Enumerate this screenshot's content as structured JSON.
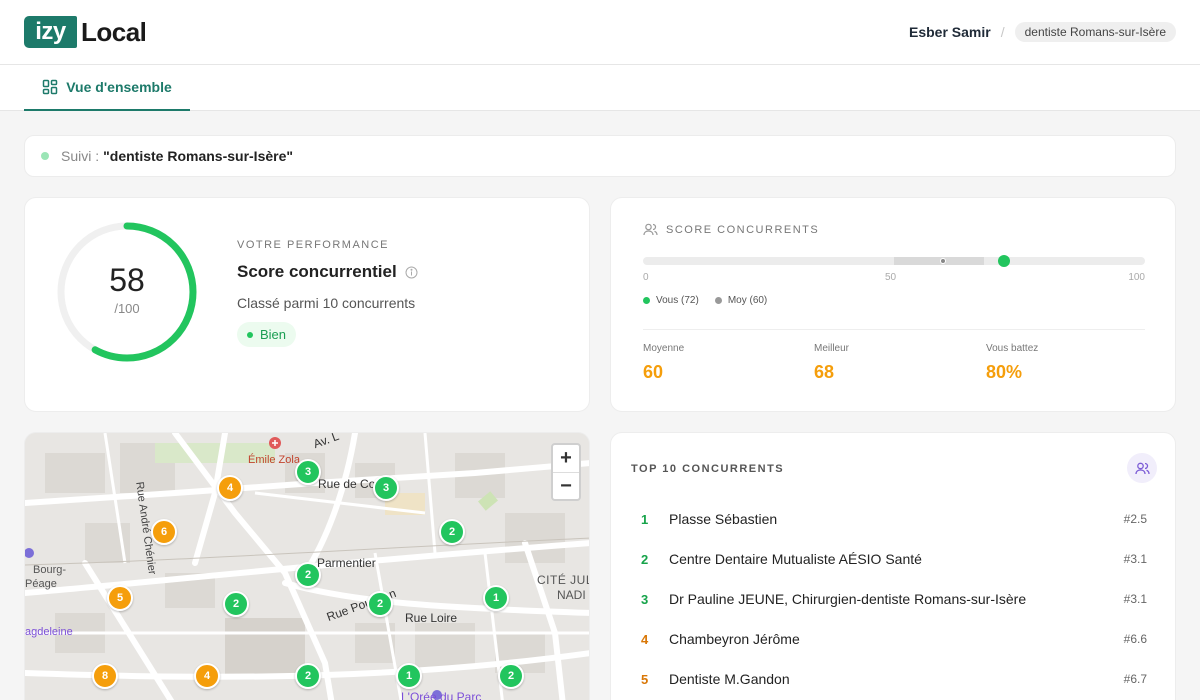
{
  "header": {
    "logo_izy": "izy",
    "logo_local": "Local",
    "user_name": "Esber Samir",
    "separator": "/",
    "keyword_pill": "dentiste Romans-sur-Isère"
  },
  "tabs": [
    {
      "label": "Vue d'ensemble",
      "active": true,
      "icon": "grid-icon"
    }
  ],
  "tracking": {
    "label": "Suivi :",
    "keyword": "\"dentiste Romans-sur-Isère\""
  },
  "performance": {
    "score": "58",
    "score_max": "/100",
    "score_fraction": 0.58,
    "kicker": "VOTRE PERFORMANCE",
    "title": "Score concurrentiel",
    "subtitle": "Classé parmi 10 concurrents",
    "badge": "Bien",
    "accent_color": "#22c55e"
  },
  "competitor_score": {
    "kicker": "SCORE CONCURRENTS",
    "you_value": 72,
    "avg_value": 60,
    "range_min_value": 50,
    "range_max_value": 68,
    "ticks": [
      "0",
      "50",
      "100"
    ],
    "legend_you": "Vous (72)",
    "legend_avg": "Moy (60)",
    "stats": [
      {
        "label": "Moyenne",
        "value": "60"
      },
      {
        "label": "Meilleur",
        "value": "68"
      },
      {
        "label": "Vous battez",
        "value": "80%"
      }
    ]
  },
  "map": {
    "zoom_in": "+",
    "zoom_out": "−",
    "labels": [
      "Émile Zola",
      "Rue de Coa",
      "Parmentier",
      "Rue Pouchon",
      "Rue Loire",
      "CITÉ JUL",
      "NADI",
      "Bourg-",
      "Péage",
      "agdeleine",
      "Rue André Chénier",
      "Av. L",
      "L'Orée du Parc"
    ],
    "markers": [
      {
        "count": "4",
        "color": "#f59e0b"
      },
      {
        "count": "3",
        "color": "#22c55e"
      },
      {
        "count": "3",
        "color": "#22c55e"
      },
      {
        "count": "6",
        "color": "#f59e0b"
      },
      {
        "count": "2",
        "color": "#22c55e"
      },
      {
        "count": "2",
        "color": "#22c55e"
      },
      {
        "count": "5",
        "color": "#f59e0b"
      },
      {
        "count": "2",
        "color": "#22c55e"
      },
      {
        "count": "2",
        "color": "#22c55e"
      },
      {
        "count": "1",
        "color": "#22c55e"
      },
      {
        "count": "8",
        "color": "#f59e0b"
      },
      {
        "count": "4",
        "color": "#f59e0b"
      },
      {
        "count": "2",
        "color": "#22c55e"
      },
      {
        "count": "1",
        "color": "#22c55e"
      },
      {
        "count": "2",
        "color": "#22c55e"
      }
    ]
  },
  "top10": {
    "title": "TOP 10 CONCURRENTS",
    "rows": [
      {
        "rank": "1",
        "name": "Plasse Sébastien",
        "position": "#2.5",
        "color": "#16a34a"
      },
      {
        "rank": "2",
        "name": "Centre Dentaire Mutualiste AÉSIO Santé",
        "position": "#3.1",
        "color": "#16a34a"
      },
      {
        "rank": "3",
        "name": "Dr Pauline JEUNE, Chirurgien-dentiste Romans-sur-Isère",
        "position": "#3.1",
        "color": "#16a34a"
      },
      {
        "rank": "4",
        "name": "Chambeyron Jérôme",
        "position": "#6.6",
        "color": "#d97706"
      },
      {
        "rank": "5",
        "name": "Dentiste M.Gandon",
        "position": "#6.7",
        "color": "#d97706"
      }
    ]
  }
}
